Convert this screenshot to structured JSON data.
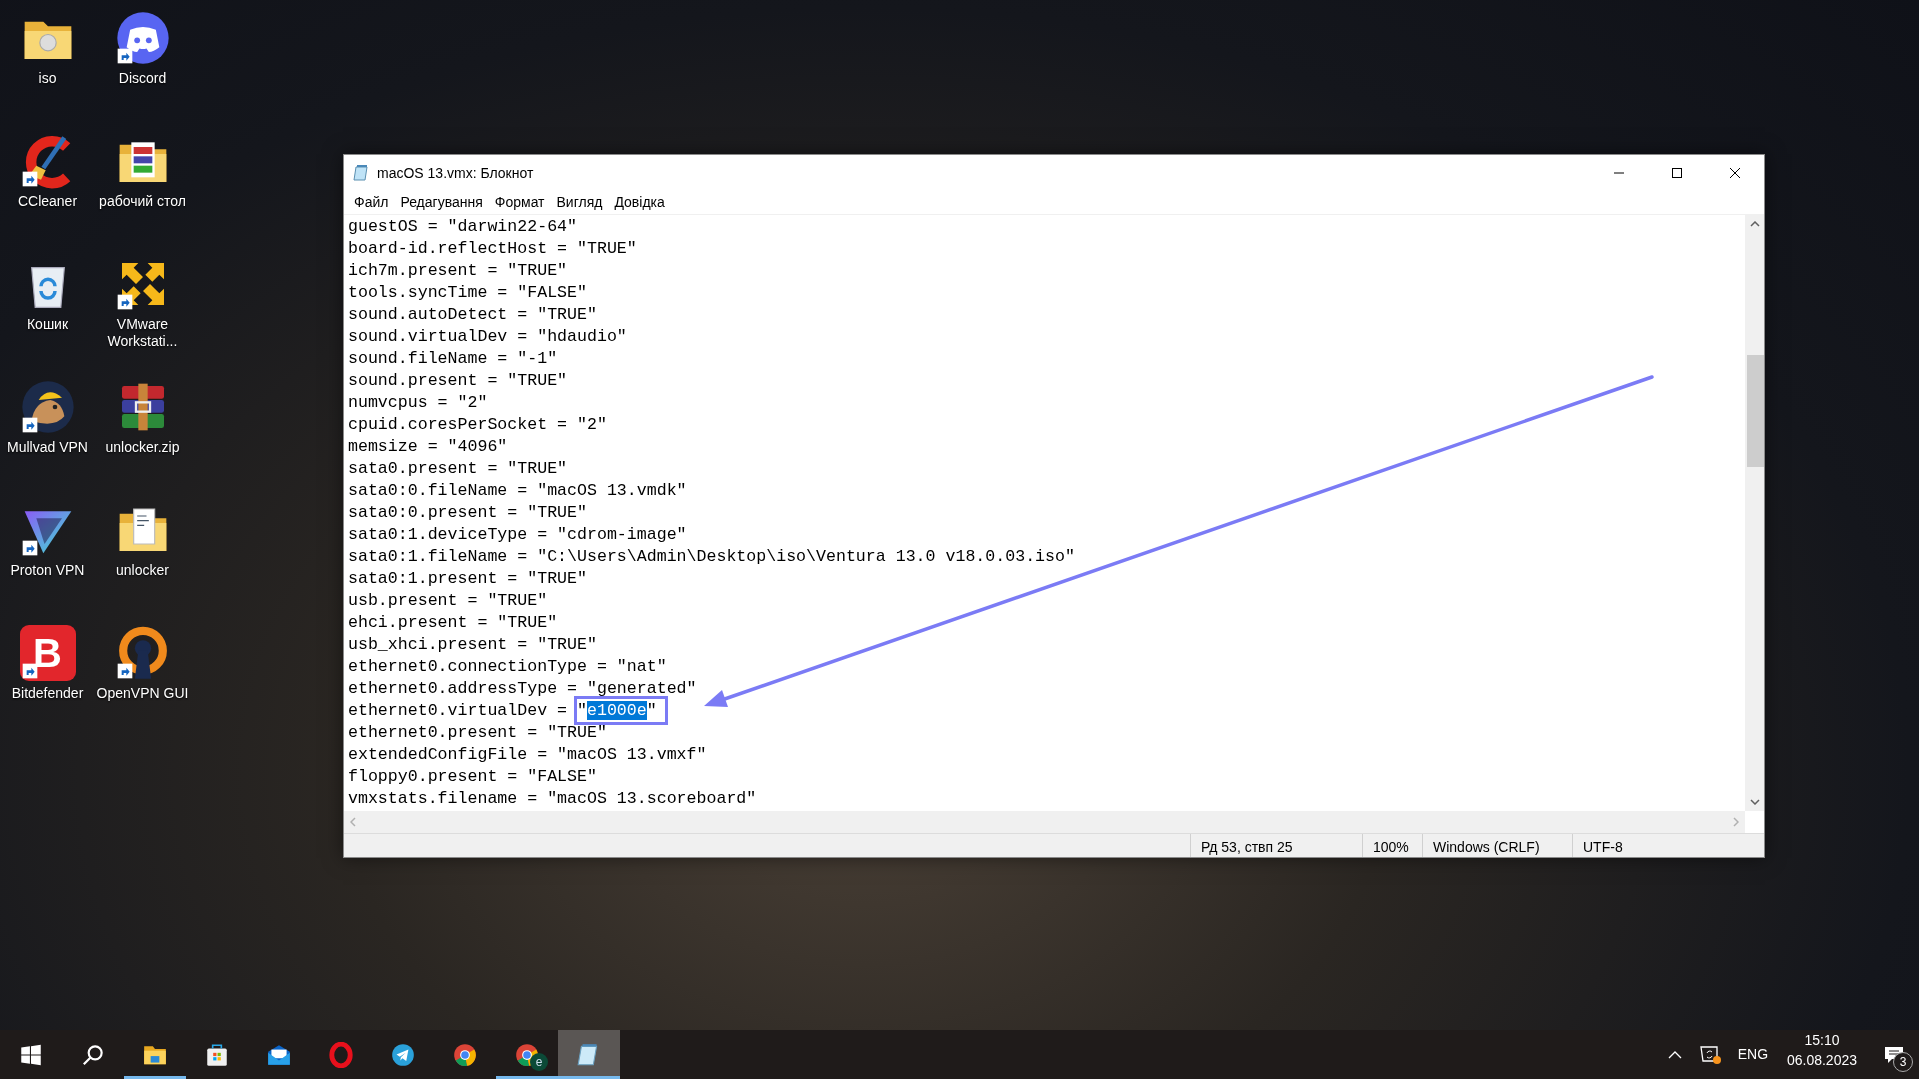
{
  "desktop": {
    "shortcuts": [
      {
        "label": "iso",
        "kind": "folder",
        "shortcut": false
      },
      {
        "label": "Discord",
        "kind": "chat",
        "shortcut": true
      },
      {
        "label": "CCleaner",
        "kind": "cleaner",
        "shortcut": true
      },
      {
        "label": "рабочий стол",
        "kind": "books",
        "shortcut": false
      },
      {
        "label": "Кошик",
        "kind": "bin",
        "shortcut": false
      },
      {
        "label": "VMware Workstati...",
        "kind": "arrows",
        "shortcut": true
      },
      {
        "label": "Mullvad VPN",
        "kind": "mole",
        "shortcut": true
      },
      {
        "label": "unlocker.zip",
        "kind": "archive",
        "shortcut": false
      },
      {
        "label": "Proton VPN",
        "kind": "triangle",
        "shortcut": true
      },
      {
        "label": "unlocker",
        "kind": "docfolder",
        "shortcut": false
      },
      {
        "label": "Bitdefender",
        "kind": "letter",
        "glyph": "B",
        "shortcut": true
      },
      {
        "label": "OpenVPN GUI",
        "kind": "keyhole",
        "shortcut": true
      }
    ]
  },
  "notepad": {
    "title": "macOS 13.vmx: Блокнот",
    "menu": [
      "Файл",
      "Редагування",
      "Формат",
      "Вигляд",
      "Довідка"
    ],
    "lines": [
      {
        "text": "guestOS = \"darwin22-64\""
      },
      {
        "text": "board-id.reflectHost = \"TRUE\""
      },
      {
        "text": "ich7m.present = \"TRUE\""
      },
      {
        "text": "tools.syncTime = \"FALSE\""
      },
      {
        "text": "sound.autoDetect = \"TRUE\""
      },
      {
        "text": "sound.virtualDev = \"hdaudio\""
      },
      {
        "text": "sound.fileName = \"-1\""
      },
      {
        "text": "sound.present = \"TRUE\""
      },
      {
        "text": "numvcpus = \"2\""
      },
      {
        "text": "cpuid.coresPerSocket = \"2\""
      },
      {
        "text": "memsize = \"4096\""
      },
      {
        "text": "sata0.present = \"TRUE\""
      },
      {
        "text": "sata0:0.fileName = \"macOS 13.vmdk\""
      },
      {
        "text": "sata0:0.present = \"TRUE\""
      },
      {
        "text": "sata0:1.deviceType = \"cdrom-image\""
      },
      {
        "text": "sata0:1.fileName = \"C:\\Users\\Admin\\Desktop\\iso\\Ventura 13.0 v18.0.03.iso\""
      },
      {
        "text": "sata0:1.present = \"TRUE\""
      },
      {
        "text": "usb.present = \"TRUE\""
      },
      {
        "text": "ehci.present = \"TRUE\""
      },
      {
        "text": "usb_xhci.present = \"TRUE\""
      },
      {
        "text": "ethernet0.connectionType = \"nat\""
      },
      {
        "text": "ethernet0.addressType = \"generated\""
      },
      {
        "parts": [
          {
            "text": "ethernet0.virtualDev = \"",
            "selected": false
          },
          {
            "text": "e1000e",
            "selected": true
          },
          {
            "text": "\"",
            "selected": false
          }
        ]
      },
      {
        "text": "ethernet0.present = \"TRUE\""
      },
      {
        "text": "extendedConfigFile = \"macOS 13.vmxf\""
      },
      {
        "text": "floppy0.present = \"FALSE\""
      },
      {
        "text": "vmxstats.filename = \"macOS 13.scoreboard\""
      }
    ],
    "status_bar": [
      "Рд 53, ствп 25",
      "100%",
      "Windows (CRLF)",
      "UTF-8"
    ]
  },
  "taskbar": {
    "apps": [
      {
        "kind": "start",
        "running": false,
        "active": false
      },
      {
        "kind": "search",
        "running": false,
        "active": false
      },
      {
        "kind": "folder",
        "running": true,
        "active": false
      },
      {
        "kind": "store",
        "running": false,
        "active": false
      },
      {
        "kind": "mail",
        "running": false,
        "active": false
      },
      {
        "kind": "ring",
        "running": false,
        "active": false
      },
      {
        "kind": "plane",
        "running": false,
        "active": false
      },
      {
        "kind": "browser",
        "running": false,
        "active": false
      },
      {
        "kind": "browser",
        "badge": "e",
        "running": true,
        "active": false
      },
      {
        "kind": "notepad",
        "running": true,
        "active": true
      }
    ],
    "tray": {
      "language": "ENG",
      "time": "15:10",
      "date": "06.08.2023",
      "notifications": "3"
    }
  }
}
